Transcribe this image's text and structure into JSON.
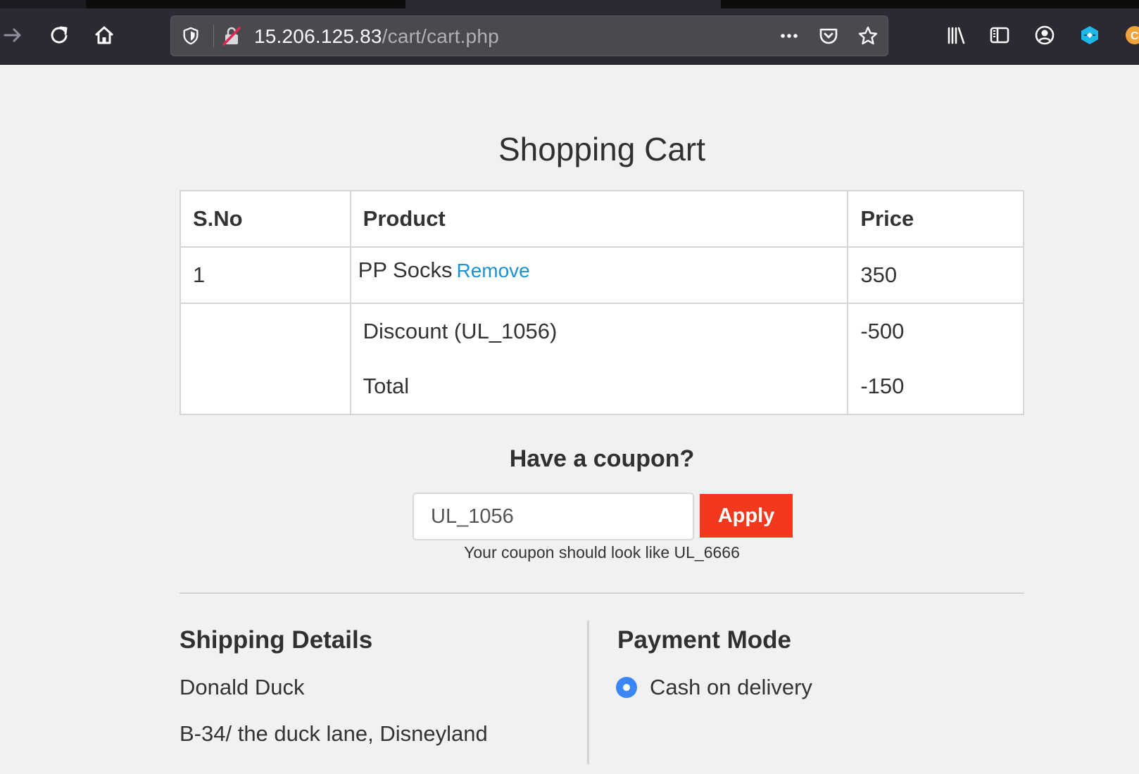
{
  "browser": {
    "url_host": "15.206.125.83",
    "url_path": "/cart/cart.php",
    "icons": [
      "forward-icon",
      "reload-icon",
      "home-icon",
      "tracking-protection-shield-icon",
      "insecure-connection-icon",
      "page-actions-more-icon",
      "pocket-icon",
      "bookmark-star-icon",
      "library-icon",
      "sidebar-icon",
      "account-icon",
      "extension-icon",
      "extension-icon-2"
    ],
    "colors": {
      "toolbar": "#2b2a33",
      "urlbar": "#4a4950",
      "ext_blue": "#1fb6e8",
      "ext_orange": "#f0a33a"
    }
  },
  "page": {
    "title": "Shopping Cart",
    "table": {
      "headers": {
        "sno": "S.No",
        "product": "Product",
        "price": "Price"
      },
      "items": [
        {
          "sno": "1",
          "product": "PP Socks",
          "remove": "Remove",
          "price": "350"
        }
      ],
      "discount_label": "Discount (UL_1056)",
      "discount_value": "-500",
      "total_label": "Total",
      "total_value": "-150"
    },
    "coupon": {
      "heading": "Have a coupon?",
      "value": "UL_1056",
      "apply": "Apply",
      "hint": "Your coupon should look like UL_6666"
    },
    "shipping": {
      "title": "Shipping Details",
      "name": "Donald Duck",
      "address": "B-34/ the duck lane, Disneyland"
    },
    "payment": {
      "title": "Payment Mode",
      "option": "Cash on delivery",
      "selected": true
    },
    "colors": {
      "background": "#f1f1f1",
      "link": "#1a93d1",
      "apply_button": "#f2391e",
      "radio": "#3b86f7"
    }
  }
}
